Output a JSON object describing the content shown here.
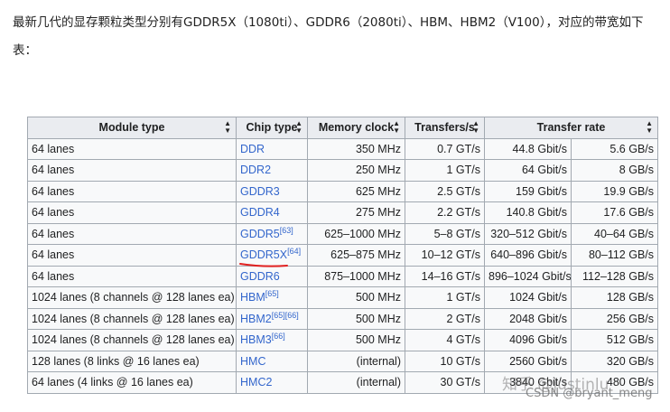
{
  "intro_text": "最新几代的显存颗粒类型分别有GDDR5X（1080ti）、GDDR6（2080ti）、HBM、HBM2（V100），对应的带宽如下表：",
  "table": {
    "headers": [
      "Module type",
      "Chip type",
      "Memory clock",
      "Transfers/s",
      "Transfer rate"
    ],
    "rows": [
      {
        "module": "64 lanes",
        "chip": "DDR",
        "ref": "",
        "clock": "350 MHz",
        "transfers": "0.7 GT/s",
        "rate_bits": "44.8 Gbit/s",
        "rate_bytes": "5.6 GB/s"
      },
      {
        "module": "64 lanes",
        "chip": "DDR2",
        "ref": "",
        "clock": "250 MHz",
        "transfers": "1 GT/s",
        "rate_bits": "64 Gbit/s",
        "rate_bytes": "8 GB/s"
      },
      {
        "module": "64 lanes",
        "chip": "GDDR3",
        "ref": "",
        "clock": "625 MHz",
        "transfers": "2.5 GT/s",
        "rate_bits": "159 Gbit/s",
        "rate_bytes": "19.9 GB/s"
      },
      {
        "module": "64 lanes",
        "chip": "GDDR4",
        "ref": "",
        "clock": "275 MHz",
        "transfers": "2.2 GT/s",
        "rate_bits": "140.8 Gbit/s",
        "rate_bytes": "17.6 GB/s"
      },
      {
        "module": "64 lanes",
        "chip": "GDDR5",
        "ref": "[63]",
        "clock": "625–1000 MHz",
        "transfers": "5–8 GT/s",
        "rate_bits": "320–512 Gbit/s",
        "rate_bytes": "40–64 GB/s"
      },
      {
        "module": "64 lanes",
        "chip": "GDDR5X",
        "ref": "[64]",
        "clock": "625–875 MHz",
        "transfers": "10–12 GT/s",
        "rate_bits": "640–896 Gbit/s",
        "rate_bytes": "80–112 GB/s"
      },
      {
        "module": "64 lanes",
        "chip": "GDDR6",
        "ref": "",
        "clock": "875–1000 MHz",
        "transfers": "14–16 GT/s",
        "rate_bits": "896–1024 Gbit/s",
        "rate_bytes": "112–128 GB/s"
      },
      {
        "module": "1024 lanes (8 channels @ 128 lanes ea)",
        "chip": "HBM",
        "ref": "[65]",
        "clock": "500 MHz",
        "transfers": "1 GT/s",
        "rate_bits": "1024 Gbit/s",
        "rate_bytes": "128 GB/s"
      },
      {
        "module": "1024 lanes (8 channels @ 128 lanes ea)",
        "chip": "HBM2",
        "ref": "[65][66]",
        "clock": "500 MHz",
        "transfers": "2 GT/s",
        "rate_bits": "2048 Gbit/s",
        "rate_bytes": "256 GB/s"
      },
      {
        "module": "1024 lanes (8 channels @ 128 lanes ea)",
        "chip": "HBM3",
        "ref": "[66]",
        "clock": "500 MHz",
        "transfers": "4 GT/s",
        "rate_bits": "4096 Gbit/s",
        "rate_bytes": "512 GB/s"
      },
      {
        "module": "128 lanes (8 links @ 16 lanes ea)",
        "chip": "HMC",
        "ref": "",
        "clock": "(internal)",
        "transfers": "10 GT/s",
        "rate_bits": "2560 Gbit/s",
        "rate_bytes": "320 GB/s"
      },
      {
        "module": "64 lanes (4 links @ 16 lanes ea)",
        "chip": "HMC2",
        "ref": "",
        "clock": "(internal)",
        "transfers": "30 GT/s",
        "rate_bits": "3840 Gbit/s",
        "rate_bytes": "480 GB/s"
      }
    ]
  },
  "watermark": {
    "zhihu": "知乎 @justinlu",
    "csdn": "CSDN @bryant_meng"
  },
  "colors": {
    "link": "#3366cc",
    "header_bg": "#eaecf0",
    "cell_bg": "#f8f9fa",
    "border": "#a2a9b1",
    "annotation": "#e02020"
  }
}
